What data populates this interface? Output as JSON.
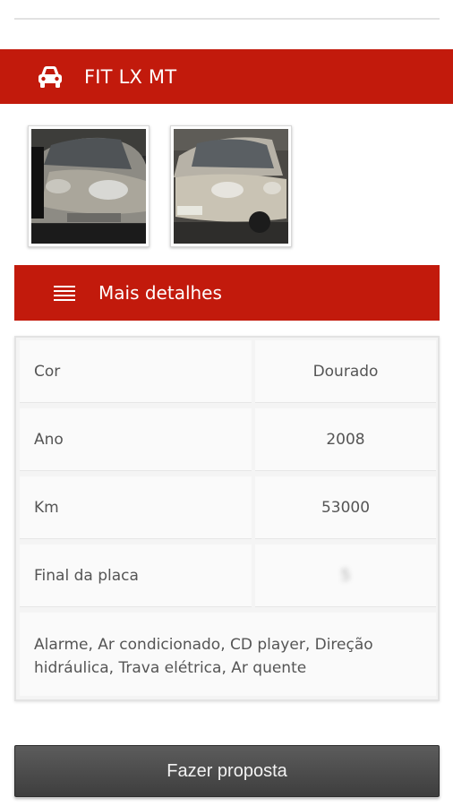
{
  "header": {
    "icon": "car-icon",
    "title": "FIT LX MT"
  },
  "photos": [
    {
      "name": "car-photo-1"
    },
    {
      "name": "car-photo-2"
    }
  ],
  "details_section": {
    "icon": "menu-icon",
    "title": "Mais detalhes"
  },
  "details": [
    {
      "label": "Cor",
      "value": "Dourado"
    },
    {
      "label": "Ano",
      "value": "2008"
    },
    {
      "label": "Km",
      "value": "53000"
    },
    {
      "label": "Final da placa",
      "value": "5"
    }
  ],
  "features_text": "Alarme, Ar condicionado, CD player, Direção hidráulica, Trava elétrica, Ar quente",
  "action": {
    "label": "Fazer proposta"
  },
  "colors": {
    "accent": "#c21a0c",
    "button": "#4a4a4a"
  }
}
